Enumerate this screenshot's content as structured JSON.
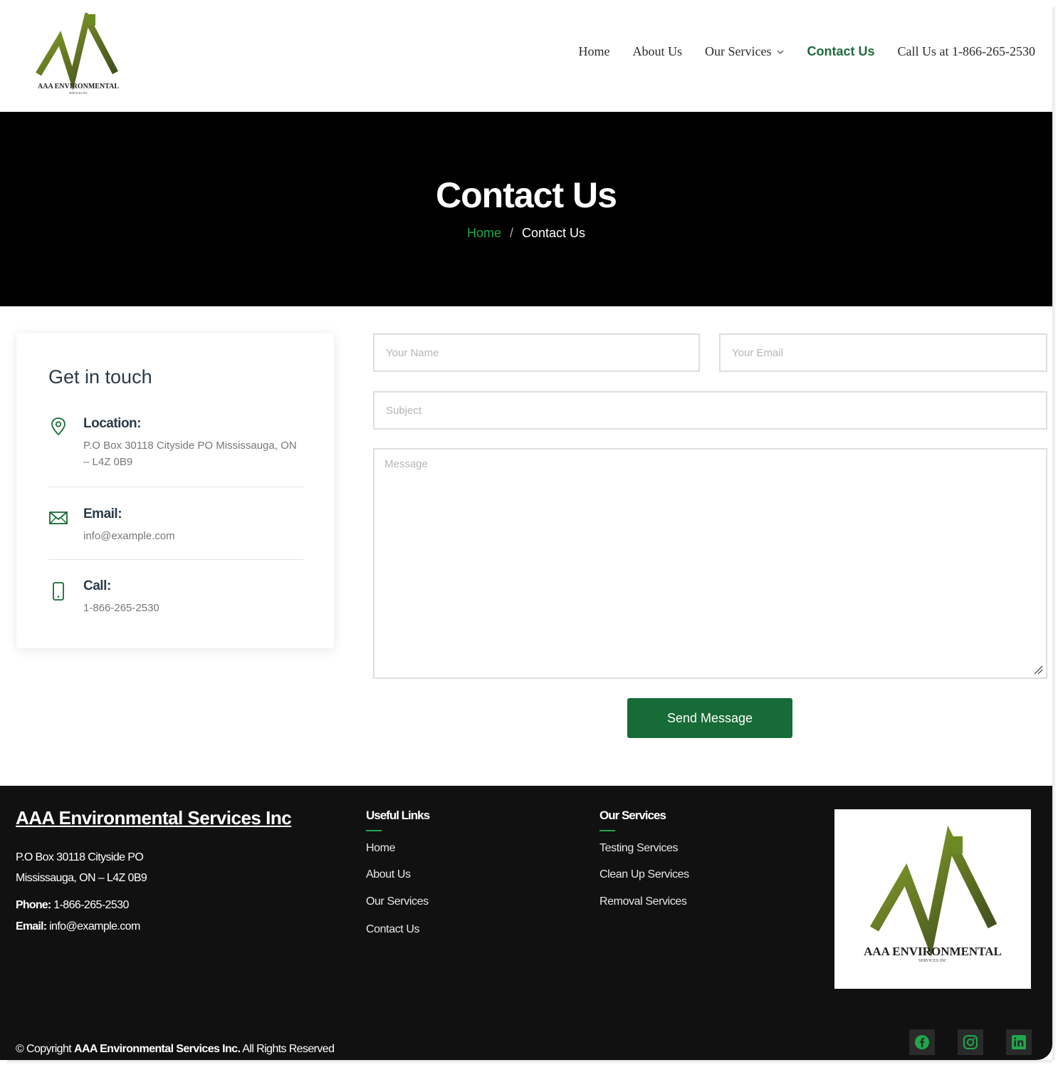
{
  "brand": {
    "logo_text": "AAA ENVIRONMENTAL",
    "logo_subtext": "SERVICES INC"
  },
  "nav": {
    "items": [
      {
        "label": "Home"
      },
      {
        "label": "About Us"
      },
      {
        "label": "Our Services"
      },
      {
        "label": "Contact Us"
      },
      {
        "label": "Call Us at 1-866-265-2530"
      }
    ],
    "active": "Contact Us"
  },
  "hero": {
    "title": "Contact Us",
    "breadcrumb_home": "Home",
    "breadcrumb_sep": "/",
    "breadcrumb_current": "Contact Us"
  },
  "contact_card": {
    "title": "Get in touch",
    "location_label": "Location:",
    "location_value": "P.O Box 30118 Cityside PO Mississauga, ON – L4Z 0B9",
    "email_label": "Email:",
    "email_value": "info@example.com",
    "call_label": "Call:",
    "call_value": "1-866-265-2530"
  },
  "form": {
    "name_placeholder": "Your Name",
    "email_placeholder": "Your Email",
    "subject_placeholder": "Subject",
    "message_placeholder": "Message",
    "submit_label": "Send Message"
  },
  "footer": {
    "company": "AAA Environmental Services Inc",
    "address_line1": "P.O Box 30118 Cityside PO",
    "address_line2": "Mississauga, ON – L4Z 0B9",
    "phone_label": "Phone:",
    "phone_value": "1-866-265-2530",
    "email_label": "Email:",
    "email_value": "info@example.com",
    "useful_links_title": "Useful Links",
    "useful_links": [
      "Home",
      "About Us",
      "Our Services",
      "Contact Us"
    ],
    "services_title": "Our Services",
    "services": [
      "Testing Services",
      "Clean Up Services",
      "Removal Services"
    ],
    "copyright_prefix": "© Copyright",
    "copyright_company": "AAA Environmental Services Inc.",
    "copyright_suffix": "All Rights Reserved",
    "social": [
      "facebook-icon",
      "instagram-icon",
      "linkedin-icon"
    ]
  },
  "colors": {
    "accent_green": "#176b36",
    "bright_green": "#1fa84a",
    "logo_olive": "#6b8a22",
    "hero_bg": "#000000",
    "footer_bg": "#111111"
  }
}
